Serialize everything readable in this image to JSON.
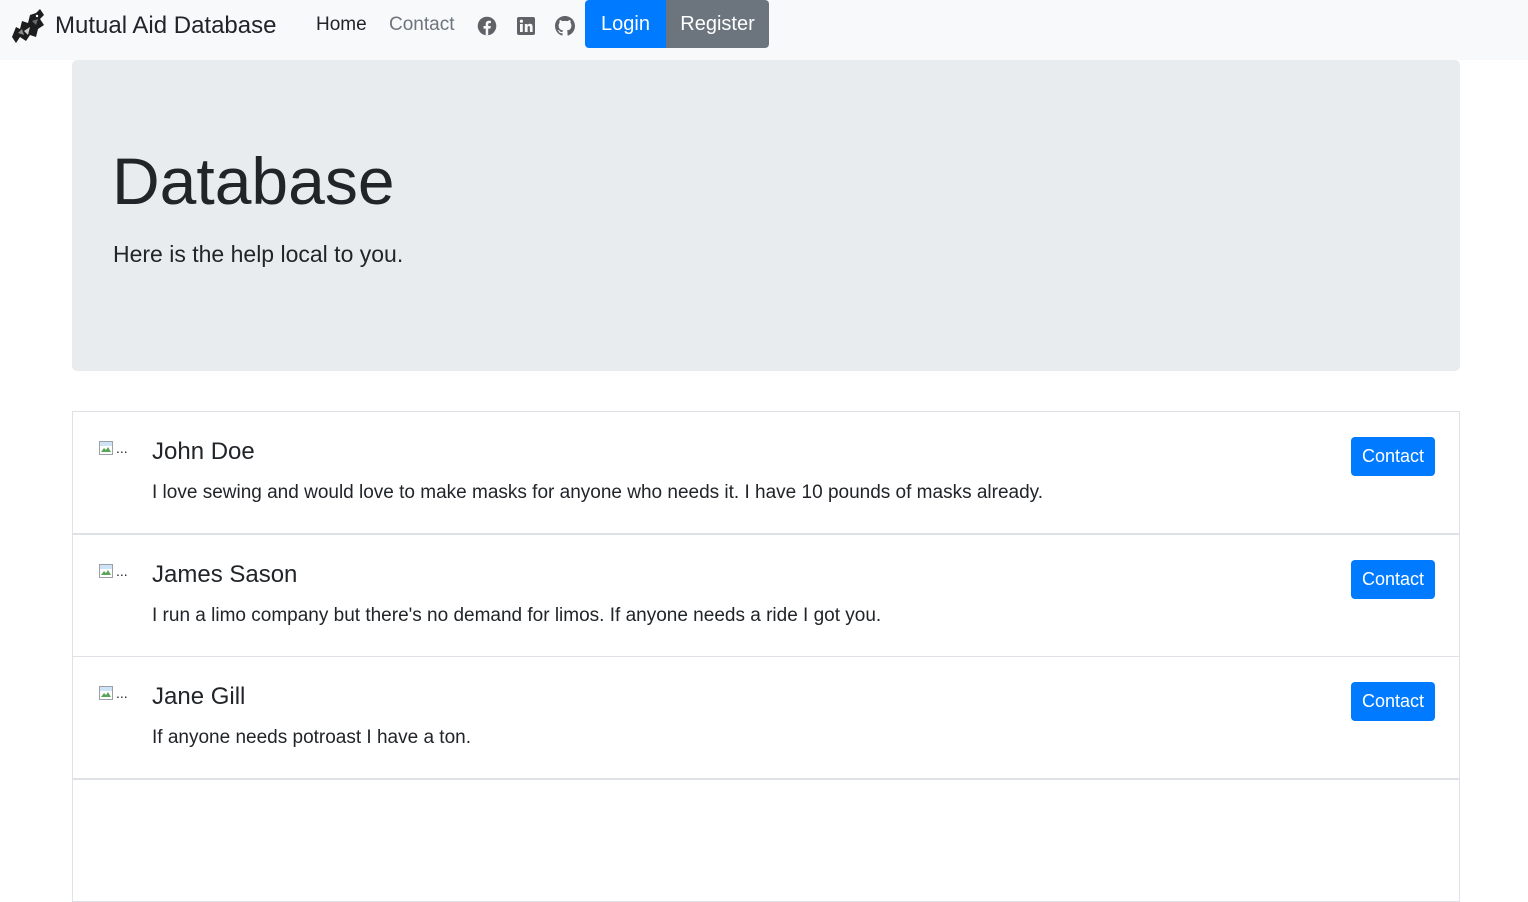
{
  "navbar": {
    "brand": "Mutual Aid Database",
    "logo_icon": "raven-logo-icon",
    "links": {
      "home": "Home",
      "contact": "Contact"
    },
    "social_icons": [
      "facebook-icon",
      "linkedin-icon",
      "github-icon"
    ],
    "login_label": "Login",
    "register_label": "Register"
  },
  "jumbotron": {
    "title": "Database",
    "lead": "Here is the help local to you."
  },
  "listings": [
    {
      "avatar_alt": "...",
      "name": "John Doe",
      "description": "I love sewing and would love to make masks for anyone who needs it. I have 10 pounds of masks already.",
      "button": "Contact"
    },
    {
      "avatar_alt": "...",
      "name": "James Sason",
      "description": "I run a limo company but there's no demand for limos. If anyone needs a ride I got you.",
      "button": "Contact"
    },
    {
      "avatar_alt": "...",
      "name": "Jane Gill",
      "description": "If anyone needs potroast I have a ton.",
      "button": "Contact"
    }
  ],
  "colors": {
    "primary": "#007bff",
    "secondary": "#6c757d",
    "navbar_bg": "#f8f9fa",
    "jumbotron_bg": "#e9ecef",
    "border": "#dee2e6",
    "text": "#212529"
  }
}
